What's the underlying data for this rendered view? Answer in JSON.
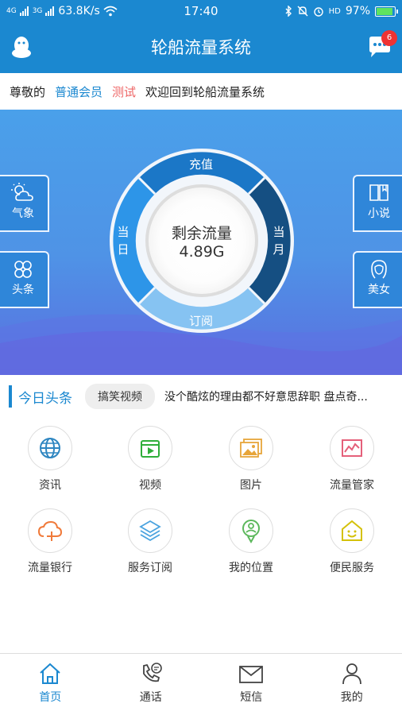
{
  "status": {
    "network_speed": "63.8K/s",
    "time": "17:40",
    "battery": "97%",
    "battery_level": 0.97,
    "signal_4g": "4G",
    "signal_3g": "3G",
    "hd": "HD"
  },
  "appbar": {
    "title": "轮船流量系统",
    "message_badge": "6"
  },
  "welcome": {
    "greeting": "尊敬的",
    "member_level": "普通会员",
    "username": "测试",
    "message": "欢迎回到轮船流量系统"
  },
  "hero": {
    "left_buttons": [
      {
        "label": "气象",
        "icon": "weather-icon"
      },
      {
        "label": "头条",
        "icon": "clover-icon"
      }
    ],
    "right_buttons": [
      {
        "label": "小说",
        "icon": "book-icon"
      },
      {
        "label": "美女",
        "icon": "woman-icon"
      }
    ],
    "dial": {
      "top": "充值",
      "left_1": "当",
      "left_2": "日",
      "right_1": "当",
      "right_2": "月",
      "bottom": "订阅",
      "center_title": "剩余流量",
      "center_value": "4.89G"
    }
  },
  "news": {
    "heading": "今日头条",
    "tag": "搞笑视频",
    "headline": "没个酷炫的理由都不好意思辞职 盘点奇..."
  },
  "services": [
    {
      "label": "资讯",
      "icon": "globe-icon",
      "color": "#2e86c1"
    },
    {
      "label": "视频",
      "icon": "video-icon",
      "color": "#2fae3a"
    },
    {
      "label": "图片",
      "icon": "pictures-icon",
      "color": "#e7a53a"
    },
    {
      "label": "流量管家",
      "icon": "chart-icon",
      "color": "#e5607a"
    },
    {
      "label": "流量银行",
      "icon": "cloud-plus-icon",
      "color": "#f07a3a"
    },
    {
      "label": "服务订阅",
      "icon": "layers-icon",
      "color": "#4aa3df"
    },
    {
      "label": "我的位置",
      "icon": "location-icon",
      "color": "#5cb85c"
    },
    {
      "label": "便民服务",
      "icon": "smile-house-icon",
      "color": "#d4c10a"
    }
  ],
  "tabs": [
    {
      "label": "首页",
      "icon": "home-icon"
    },
    {
      "label": "通话",
      "icon": "phone-icon"
    },
    {
      "label": "短信",
      "icon": "mail-icon"
    },
    {
      "label": "我的",
      "icon": "person-icon"
    }
  ],
  "colors": {
    "primary": "#1b88d0",
    "accent_red": "#e66"
  }
}
